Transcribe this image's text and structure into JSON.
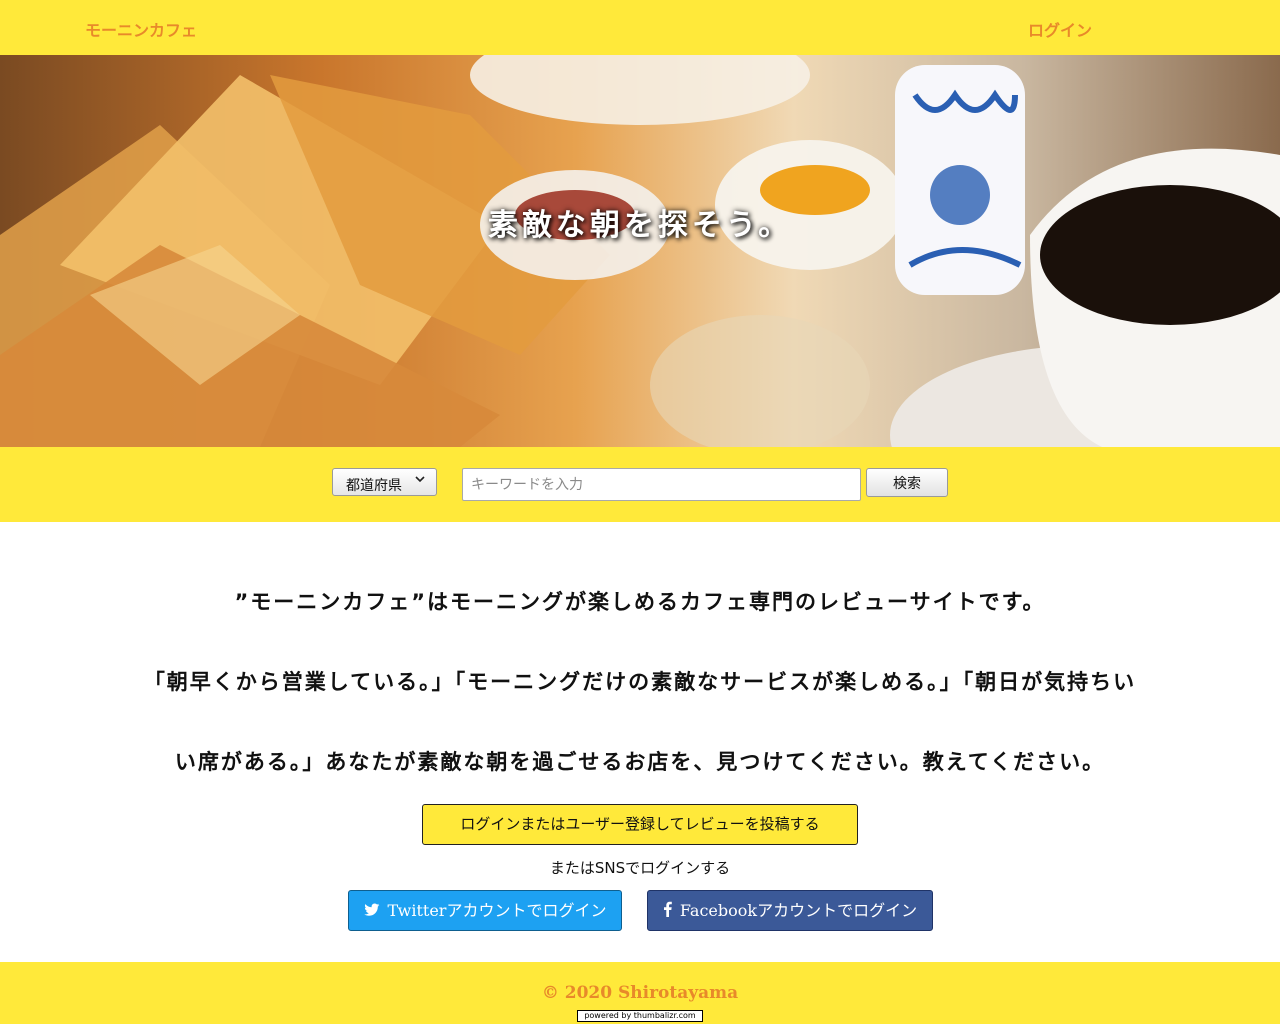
{
  "header": {
    "brand": "モーニンカフェ",
    "login": "ログイン"
  },
  "hero": {
    "title": "素敵な朝を探そう。"
  },
  "search": {
    "prefecture_selected": "都道府県",
    "keyword_placeholder": "キーワードを入力",
    "search_button": "検索"
  },
  "intro": {
    "line1": "”モーニンカフェ”はモーニングが楽しめるカフェ専門のレビューサイトです。",
    "line2": "「朝早くから営業している。」「モーニングだけの素敵なサービスが楽しめる。」「朝日が気持ちい",
    "line3": "い席がある。」あなたが素敵な朝を過ごせるお店を、見つけてください。教えてください。"
  },
  "cta": {
    "register_button": "ログインまたはユーザー登録してレビューを投稿する",
    "sns_note": "またはSNSでログインする",
    "twitter_button": "Twitterアカウントでログイン",
    "facebook_button": "Facebookアカウントでログイン"
  },
  "footer": {
    "copyright": "© 2020 Shirotayama",
    "powered_by": "powered by thumbalizr.com"
  },
  "colors": {
    "accent_yellow": "#ffe93a",
    "brand_orange": "#e8892a",
    "twitter_blue": "#1da1f2",
    "facebook_blue": "#3b5998"
  },
  "icons": {
    "twitter": "twitter-bird-icon",
    "facebook": "facebook-f-icon",
    "select": "chevron-down-icon"
  }
}
